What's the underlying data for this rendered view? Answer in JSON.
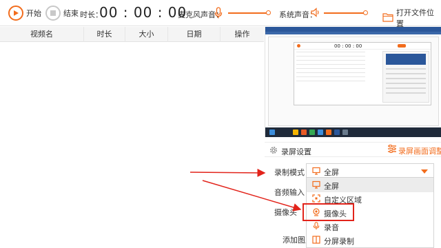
{
  "toolbar": {
    "start_label": "开始",
    "stop_label": "结束",
    "duration_label": "时长：",
    "timer": "00 : 00 : 00",
    "mic_label": "麦克风声音：",
    "system_label": "系统声音：",
    "open_folder_label": "打开文件位置"
  },
  "table": {
    "columns": [
      "视频名",
      "时长",
      "大小",
      "日期",
      "操作"
    ]
  },
  "preview": {
    "timer": "00 : 00 : 00"
  },
  "settings": {
    "title": "录屏设置",
    "adjust_label": "录屏画面调整",
    "mode_label": "录制模式",
    "audio_label": "音频输入",
    "camera_label": "摄像头",
    "add_image_label": "添加图片",
    "mode_selected": "全屏",
    "mode_options": [
      "全屏",
      "自定义区域",
      "摄像头",
      "录音",
      "分屏录制"
    ],
    "highlighted_option": "摄像头"
  },
  "colors": {
    "accent": "#f26c1c",
    "annotation_red": "#e2231a"
  }
}
